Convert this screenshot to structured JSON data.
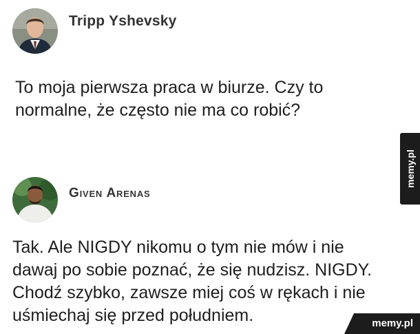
{
  "posts": [
    {
      "author": "Tripp Yshevsky",
      "avatar_icon": "person-avatar-icon",
      "lines": [
        "To moja pierwsza praca w biurze. Czy to",
        "normalne, że często nie ma co robić?"
      ]
    },
    {
      "author": "Given Arenas",
      "avatar_icon": "person-avatar-icon",
      "lines": [
        "Tak. Ale NIGDY nikomu o tym nie mów i nie",
        "dawaj po sobie poznać, że się nudzisz. NIGDY.",
        "Chodź szybko, zawsze miej coś w rękach i nie",
        "uśmiechaj się przed południem."
      ]
    }
  ],
  "watermarks": {
    "side": "memy.pl",
    "corner": "memy.pl"
  },
  "colors": {
    "text": "#1e1e1e",
    "author": "#333333",
    "watermark_bg": "#1c1c1c",
    "watermark_text": "#ffffff"
  }
}
